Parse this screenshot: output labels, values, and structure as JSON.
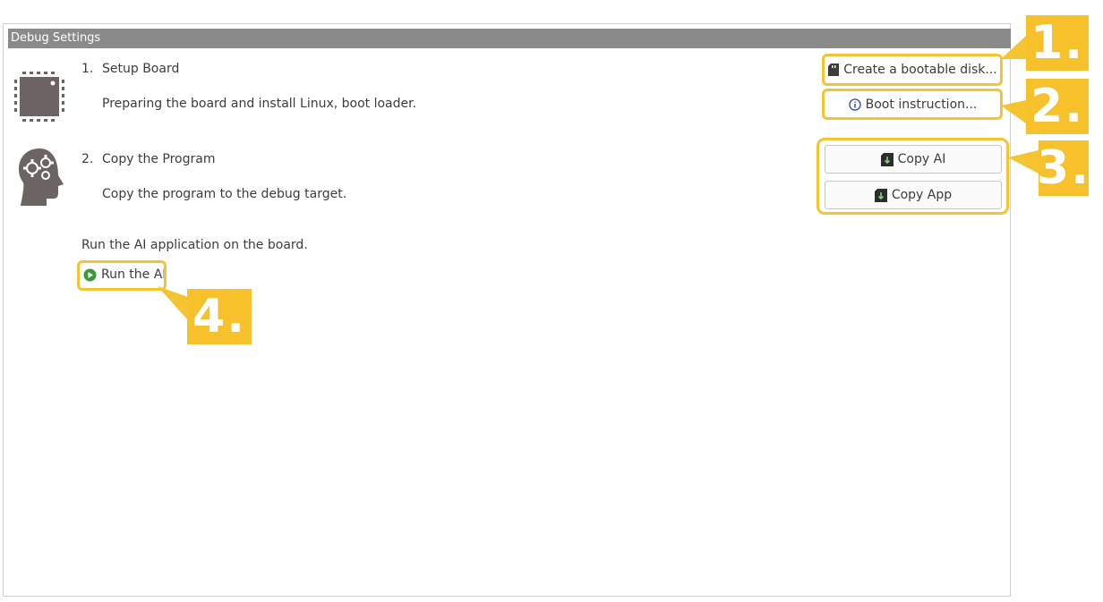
{
  "panel": {
    "title": "Debug Settings"
  },
  "step1": {
    "number": "1.",
    "title": "Setup Board",
    "description": "Preparing the board and install Linux, boot loader.",
    "icon": "chip-icon"
  },
  "step2": {
    "number": "2.",
    "title": "Copy the Program",
    "description": "Copy the program to the debug target.",
    "icon": "head-gears-icon"
  },
  "buttons": {
    "create_disk": "Create a bootable disk...",
    "boot_instruction": "Boot instruction...",
    "copy_ai": "Copy AI",
    "copy_app": "Copy App"
  },
  "run": {
    "description": "Run the AI application on the board.",
    "link": "Run the AI"
  },
  "callouts": [
    "1.",
    "2.",
    "3.",
    "4."
  ],
  "colors": {
    "highlight": "#f5c431",
    "badge": "#f7c12c",
    "titlebar": "#8a8a8a",
    "run_icon": "#3a9a3a"
  }
}
